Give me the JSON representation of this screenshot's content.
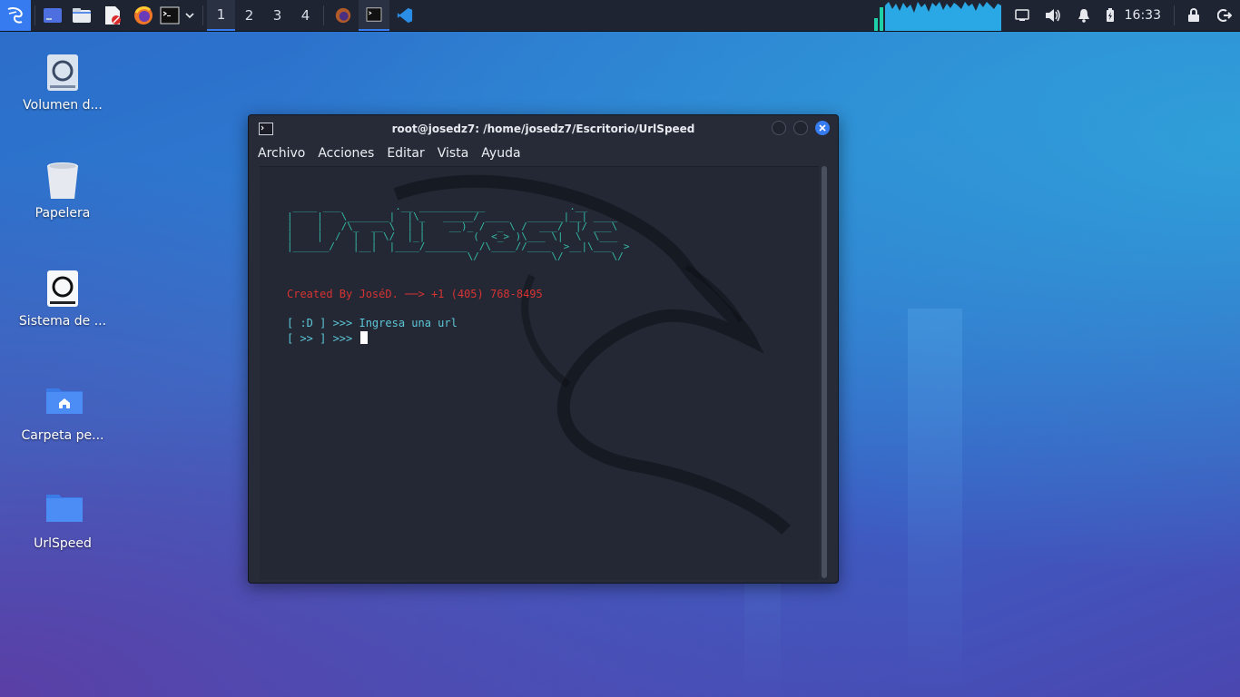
{
  "taskbar": {
    "workspaces": [
      "1",
      "2",
      "3",
      "4"
    ],
    "active_workspace": "1",
    "clock": "16:33",
    "icons": [
      "kali-menu-icon",
      "desktop-icon",
      "file-manager-icon",
      "text-editor-icon",
      "firefox-icon",
      "terminal-icon",
      "chevron-down-icon"
    ],
    "tray_icons": [
      "network-icon",
      "volume-icon",
      "bell-icon",
      "battery-icon",
      "lock-icon",
      "logout-icon"
    ]
  },
  "desktop": {
    "icons": [
      {
        "label": "Volumen d...",
        "icon": "drive-icon"
      },
      {
        "label": "Papelera",
        "icon": "trash-icon"
      },
      {
        "label": "Sistema de ...",
        "icon": "filesystem-icon"
      },
      {
        "label": "Carpeta pe...",
        "icon": "home-folder-icon"
      },
      {
        "label": "UrlSpeed",
        "icon": "folder-icon"
      }
    ]
  },
  "terminal": {
    "title": "root@josedz7: /home/josedz7/Escritorio/UrlSpeed",
    "menu": [
      "Archivo",
      "Acciones",
      "Editar",
      "Vista",
      "Ayuda"
    ],
    "banner": " ____ ___         .__ ___________              .__\n|    |   \\_______|  |\\_   _____/ ____   ______|__| ____\n|    |   /\\_  __ \\  | |    __)_ /  _ \\ /  ___/  |/ ___\\\n|    |  /  |  | \\/  |_|        (  <_> )\\___ \\|  \\  \\___\n|______/   |__|  |____/_______  /\\____//____  >__|\\___  >\n                              \\/            \\/        \\/",
    "credit": "Created By JoséD. ──> +1 (405) 768-8495",
    "prompt1": "[ :D ] >>> Ingresa una url",
    "prompt2": "[ >> ] >>> ",
    "colors": {
      "banner": "#35b8a6",
      "credit": "#d63333",
      "prompt": "#5ec7d6"
    }
  }
}
